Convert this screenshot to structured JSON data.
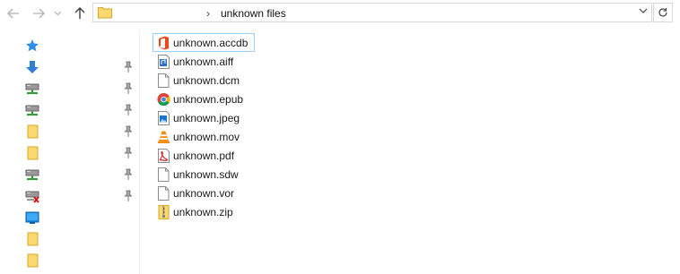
{
  "address_bar": {
    "path": "unknown files"
  },
  "nav_pane": {
    "items": [
      {
        "icon": "quick-access-star-icon",
        "pinned": false
      },
      {
        "icon": "downloads-arrow-icon",
        "pinned": true
      },
      {
        "icon": "network-drive-icon",
        "pinned": true
      },
      {
        "icon": "network-drive-icon",
        "pinned": true
      },
      {
        "icon": "folder-icon",
        "pinned": true
      },
      {
        "icon": "folder-icon",
        "pinned": true
      },
      {
        "icon": "network-drive-icon",
        "pinned": true
      },
      {
        "icon": "disconnected-drive-icon",
        "pinned": true
      },
      {
        "icon": "desktop-icon",
        "pinned": false
      },
      {
        "icon": "folder-icon",
        "pinned": false
      },
      {
        "icon": "folder-icon",
        "pinned": false
      }
    ]
  },
  "files": [
    {
      "name": "unknown.accdb",
      "icon": "office-icon",
      "selected": true
    },
    {
      "name": "unknown.aiff",
      "icon": "audio-file-icon",
      "selected": false
    },
    {
      "name": "unknown.dcm",
      "icon": "blank-file-icon",
      "selected": false
    },
    {
      "name": "unknown.epub",
      "icon": "chrome-icon",
      "selected": false
    },
    {
      "name": "unknown.jpeg",
      "icon": "image-file-icon",
      "selected": false
    },
    {
      "name": "unknown.mov",
      "icon": "vlc-cone-icon",
      "selected": false
    },
    {
      "name": "unknown.pdf",
      "icon": "pdf-file-icon",
      "selected": false
    },
    {
      "name": "unknown.sdw",
      "icon": "blank-file-icon",
      "selected": false
    },
    {
      "name": "unknown.vor",
      "icon": "blank-file-icon",
      "selected": false
    },
    {
      "name": "unknown.zip",
      "icon": "zip-folder-icon",
      "selected": false
    }
  ]
}
